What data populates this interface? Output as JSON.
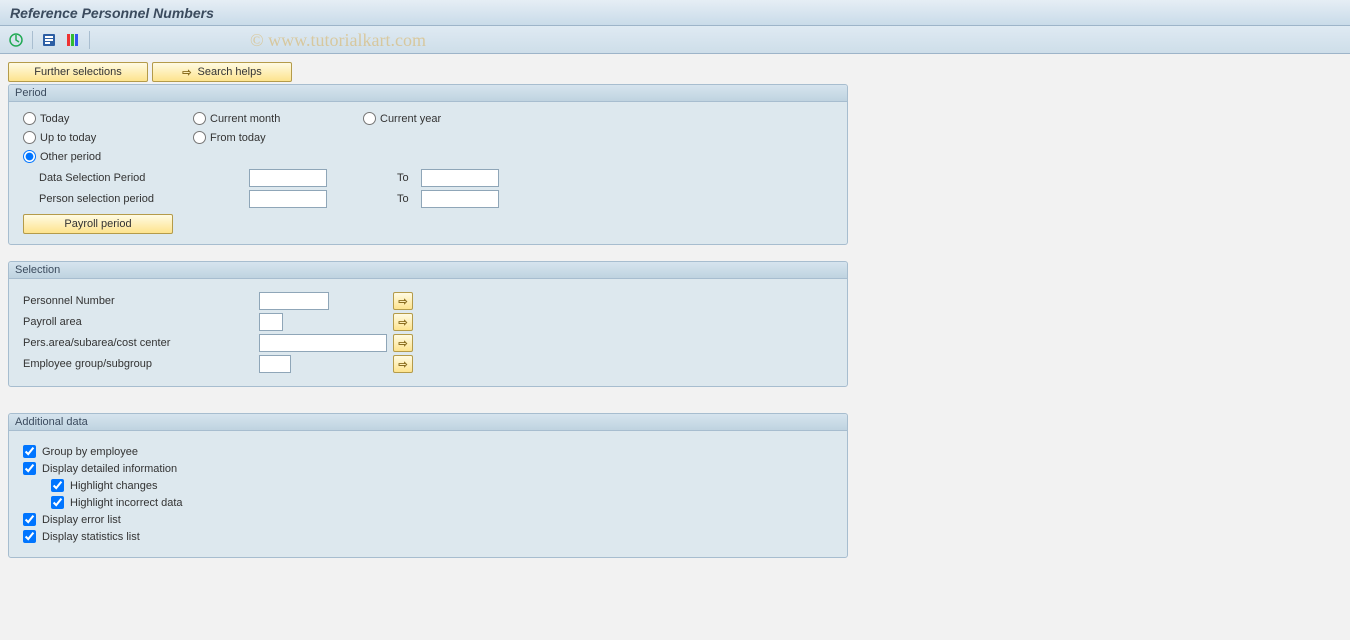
{
  "title": "Reference Personnel Numbers",
  "watermark": "© www.tutorialkart.com",
  "toolbar_buttons": {
    "further_selections": "Further selections",
    "search_helps": "Search helps"
  },
  "panels": {
    "period": {
      "header": "Period",
      "radios": {
        "today": "Today",
        "current_month": "Current month",
        "current_year": "Current year",
        "up_to_today": "Up to today",
        "from_today": "From today",
        "other_period": "Other period"
      },
      "fields": {
        "data_selection_period": "Data Selection Period",
        "person_selection_period": "Person selection period",
        "to": "To"
      },
      "payroll_button": "Payroll period"
    },
    "selection": {
      "header": "Selection",
      "rows": {
        "personnel_number": "Personnel Number",
        "payroll_area": "Payroll area",
        "pers_area": "Pers.area/subarea/cost center",
        "emp_group": "Employee group/subgroup"
      }
    },
    "additional": {
      "header": "Additional data",
      "checks": {
        "group_by_employee": "Group by employee",
        "display_detailed": "Display detailed information",
        "highlight_changes": "Highlight changes",
        "highlight_incorrect": "Highlight incorrect data",
        "display_error_list": "Display error list",
        "display_statistics": "Display statistics list"
      }
    }
  },
  "values": {
    "data_sel_from": "",
    "data_sel_to": "",
    "person_sel_from": "",
    "person_sel_to": "",
    "personnel_number": "",
    "payroll_area": "",
    "pers_area": "",
    "emp_group": ""
  }
}
